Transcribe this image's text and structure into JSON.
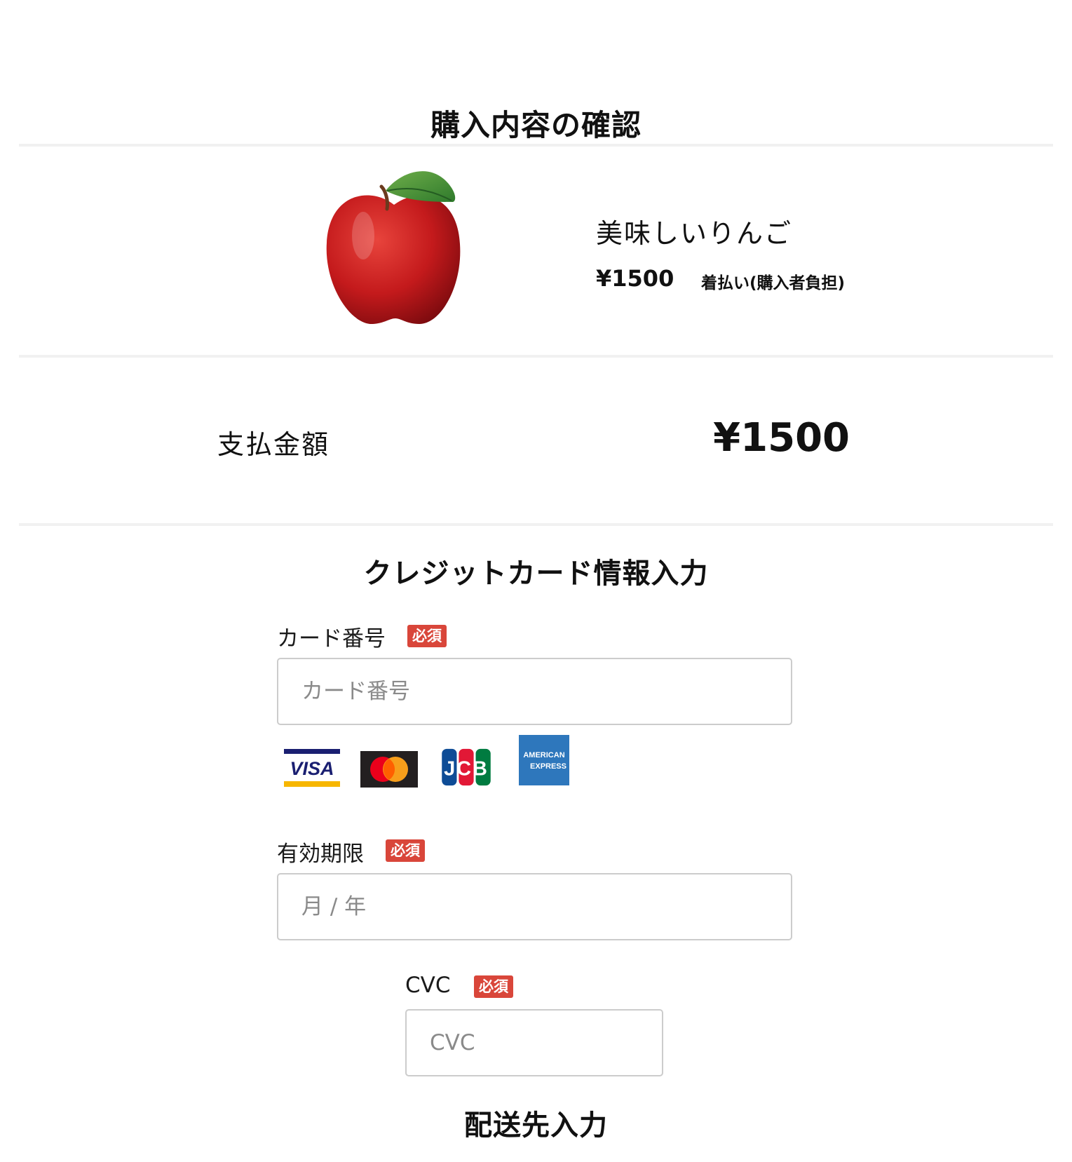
{
  "header": {
    "title": "購入内容の確認"
  },
  "product": {
    "image": "apple-photo",
    "name": "美味しいりんご",
    "price": "¥1500",
    "shipping": "着払い(購入者負担)"
  },
  "payment": {
    "label": "支払金額",
    "amount": "¥1500"
  },
  "card_section": {
    "title": "クレジットカード情報入力",
    "card_number": {
      "label": "カード番号",
      "required": "必須",
      "placeholder": "カード番号",
      "value": ""
    },
    "brands": [
      {
        "name": "VISA",
        "text": "VISA",
        "icon": "visa-logo"
      },
      {
        "name": "Mastercard",
        "icon": "mastercard-logo"
      },
      {
        "name": "JCB",
        "text": "JCB",
        "icon": "jcb-logo"
      },
      {
        "name": "American Express",
        "text": [
          "AMERICAN",
          "EXPRESS"
        ],
        "icon": "amex-logo"
      }
    ],
    "expiry": {
      "label": "有効期限",
      "required": "必須",
      "placeholder": "月 / 年",
      "value": ""
    },
    "cvc": {
      "label": "CVC",
      "required": "必須",
      "placeholder": "CVC",
      "value": ""
    }
  },
  "shipping_section": {
    "title": "配送先入力"
  },
  "colors": {
    "required_badge": "#d9463a",
    "divider": "#f1f1f1",
    "input_border": "#cccccc",
    "placeholder": "#8a8a8a"
  }
}
